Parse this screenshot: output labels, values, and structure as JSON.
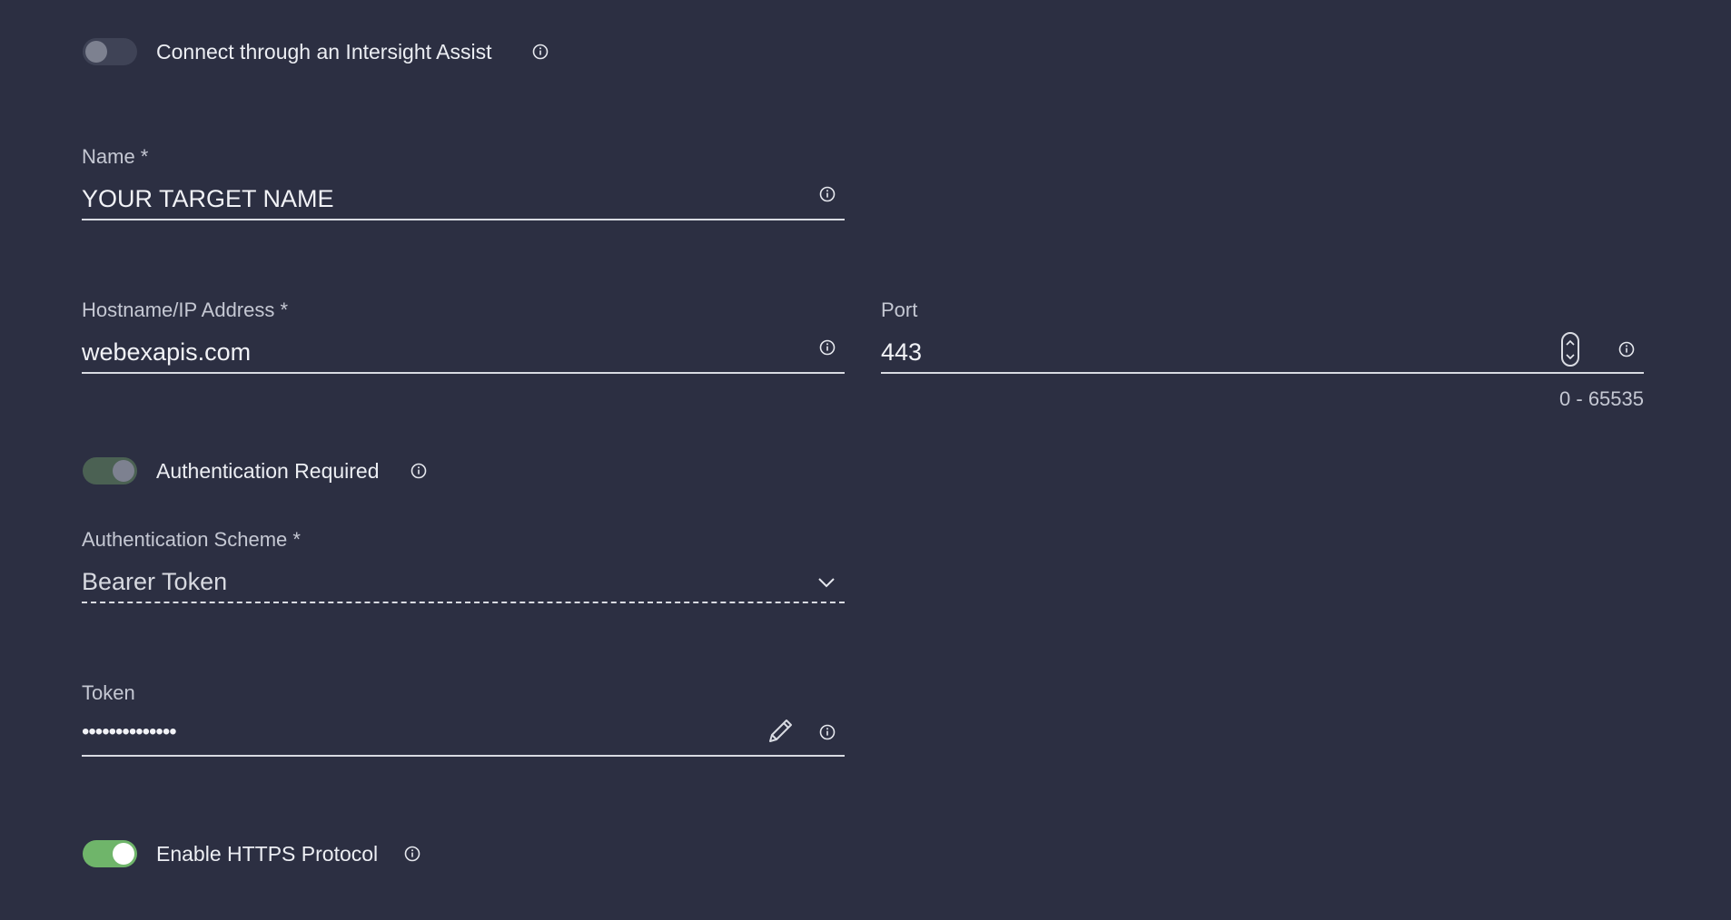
{
  "assist": {
    "label": "Connect through an Intersight Assist",
    "enabled": false
  },
  "name_field": {
    "label": "Name *",
    "value": "YOUR TARGET NAME"
  },
  "hostname_field": {
    "label": "Hostname/IP Address *",
    "value": "webexapis.com"
  },
  "port_field": {
    "label": "Port",
    "value": "443",
    "range_hint": "0 - 65535"
  },
  "auth_required": {
    "label": "Authentication Required",
    "enabled": true
  },
  "auth_scheme": {
    "label": "Authentication Scheme *",
    "value": "Bearer Token"
  },
  "token_field": {
    "label": "Token",
    "value": "••••••••••••••"
  },
  "https": {
    "label": "Enable HTTPS Protocol",
    "enabled": true
  },
  "colors": {
    "background": "#2c2f42",
    "toggle_on": "#6fb56a",
    "toggle_off": "#3f4356"
  },
  "icons": {
    "info": "info-circle-icon",
    "edit": "pencil-icon",
    "dropdown": "chevron-down-icon",
    "stepper": "up-down-stepper-icon"
  }
}
